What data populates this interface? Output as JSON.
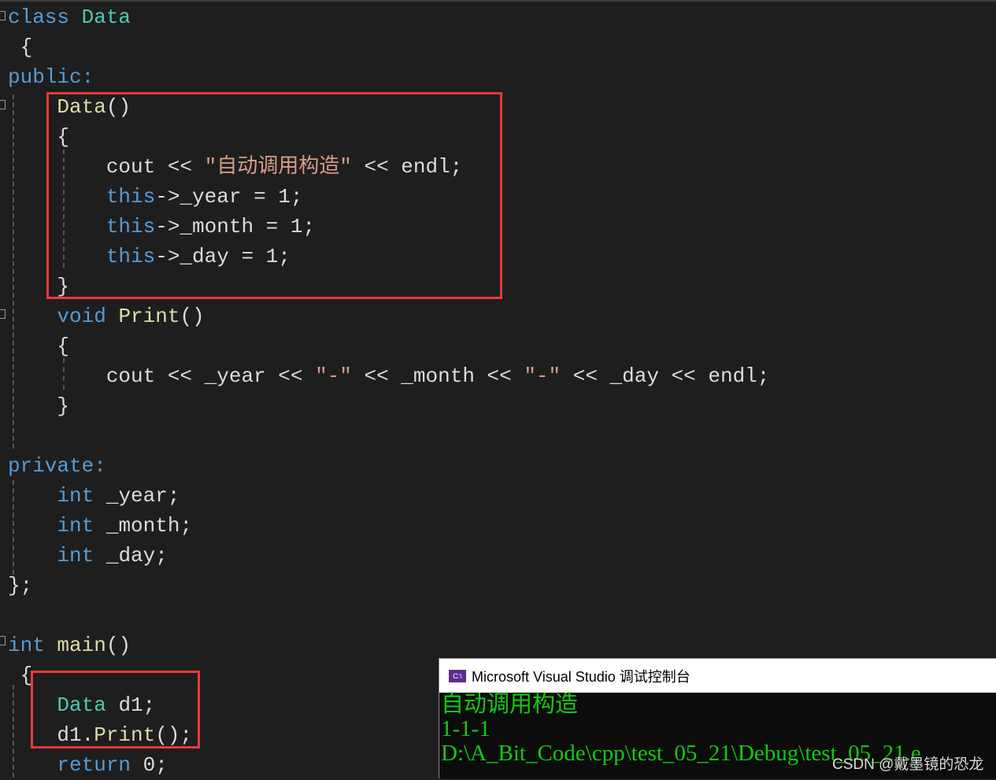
{
  "code_lines": [
    [
      [
        "class ",
        "kw"
      ],
      [
        "Data",
        "ty"
      ]
    ],
    [
      [
        " {",
        "pl"
      ]
    ],
    [
      [
        "public:",
        "kw"
      ]
    ],
    [
      [
        "    ",
        "pl"
      ],
      [
        "Data",
        "fn"
      ],
      [
        "()",
        "pl"
      ]
    ],
    [
      [
        "    {",
        "pl"
      ]
    ],
    [
      [
        "        cout << ",
        "pl"
      ],
      [
        "\"自动调用构造\"",
        "str"
      ],
      [
        " << endl;",
        "pl"
      ]
    ],
    [
      [
        "        ",
        "pl"
      ],
      [
        "this",
        "kw"
      ],
      [
        "->_year = 1;",
        "pl"
      ]
    ],
    [
      [
        "        ",
        "pl"
      ],
      [
        "this",
        "kw"
      ],
      [
        "->_month = 1;",
        "pl"
      ]
    ],
    [
      [
        "        ",
        "pl"
      ],
      [
        "this",
        "kw"
      ],
      [
        "->_day = 1;",
        "pl"
      ]
    ],
    [
      [
        "    }",
        "pl"
      ]
    ],
    [
      [
        "    ",
        "pl"
      ],
      [
        "void ",
        "kw"
      ],
      [
        "Print",
        "fn"
      ],
      [
        "()",
        "pl"
      ]
    ],
    [
      [
        "    {",
        "pl"
      ]
    ],
    [
      [
        "        cout << _year << ",
        "pl"
      ],
      [
        "\"-\"",
        "str"
      ],
      [
        " << _month << ",
        "pl"
      ],
      [
        "\"-\"",
        "str"
      ],
      [
        " << _day << endl;",
        "pl"
      ]
    ],
    [
      [
        "    }",
        "pl"
      ]
    ],
    [
      [
        "",
        "pl"
      ]
    ],
    [
      [
        "private:",
        "kw"
      ]
    ],
    [
      [
        "    ",
        "pl"
      ],
      [
        "int ",
        "kw"
      ],
      [
        "_year;",
        "pl"
      ]
    ],
    [
      [
        "    ",
        "pl"
      ],
      [
        "int ",
        "kw"
      ],
      [
        "_month;",
        "pl"
      ]
    ],
    [
      [
        "    ",
        "pl"
      ],
      [
        "int ",
        "kw"
      ],
      [
        "_day;",
        "pl"
      ]
    ],
    [
      [
        "};",
        "pl"
      ]
    ],
    [
      [
        "",
        "pl"
      ]
    ],
    [
      [
        "int ",
        "kw"
      ],
      [
        "main",
        "fn"
      ],
      [
        "()",
        "pl"
      ]
    ],
    [
      [
        " {",
        "pl"
      ]
    ],
    [
      [
        "    ",
        "pl"
      ],
      [
        "Data ",
        "ty"
      ],
      [
        "d1;",
        "pl"
      ]
    ],
    [
      [
        "    d1.",
        "pl"
      ],
      [
        "Print",
        "fn"
      ],
      [
        "();",
        "pl"
      ]
    ],
    [
      [
        "    ",
        "pl"
      ],
      [
        "return ",
        "kw"
      ],
      [
        "0;",
        "pl"
      ]
    ]
  ],
  "console": {
    "title": "Microsoft Visual Studio 调试控制台",
    "icon": "console-app-icon",
    "icon_text": "C:\\",
    "output": [
      "自动调用构造",
      "1-1-1",
      "",
      "D:\\A_Bit_Code\\cpp\\test_05_21\\Debug\\test_05_21.e"
    ]
  },
  "watermark": "CSDN @戴墨镜的恐龙",
  "colors": {
    "keyword": "#569cd6",
    "type": "#4ec9b0",
    "function": "#dcdcaa",
    "string": "#d69d85",
    "highlight_box": "#e83a3a",
    "console_text": "#13c813"
  }
}
